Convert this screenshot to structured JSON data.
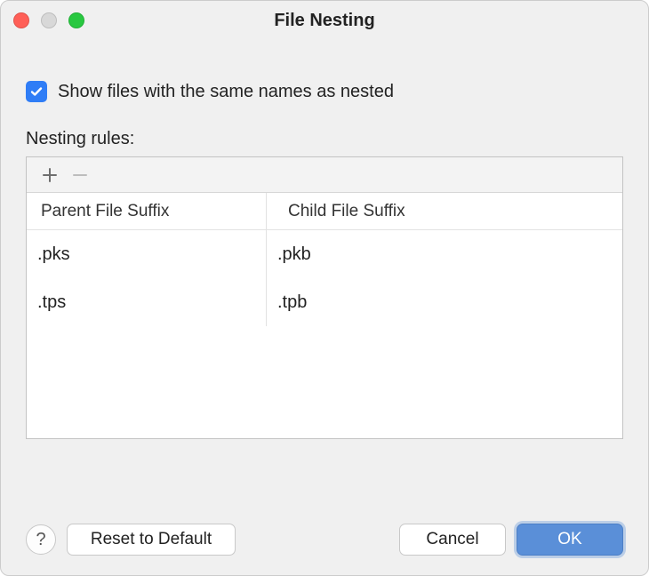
{
  "window": {
    "title": "File Nesting"
  },
  "checkbox": {
    "label": "Show files with the same names as nested",
    "checked": true
  },
  "section_label": "Nesting rules:",
  "table": {
    "headers": {
      "parent": "Parent File Suffix",
      "child": "Child File Suffix"
    },
    "rows": [
      {
        "parent": ".pks",
        "child": ".pkb"
      },
      {
        "parent": ".tps",
        "child": ".tpb"
      }
    ]
  },
  "buttons": {
    "help": "?",
    "reset": "Reset to Default",
    "cancel": "Cancel",
    "ok": "OK"
  }
}
